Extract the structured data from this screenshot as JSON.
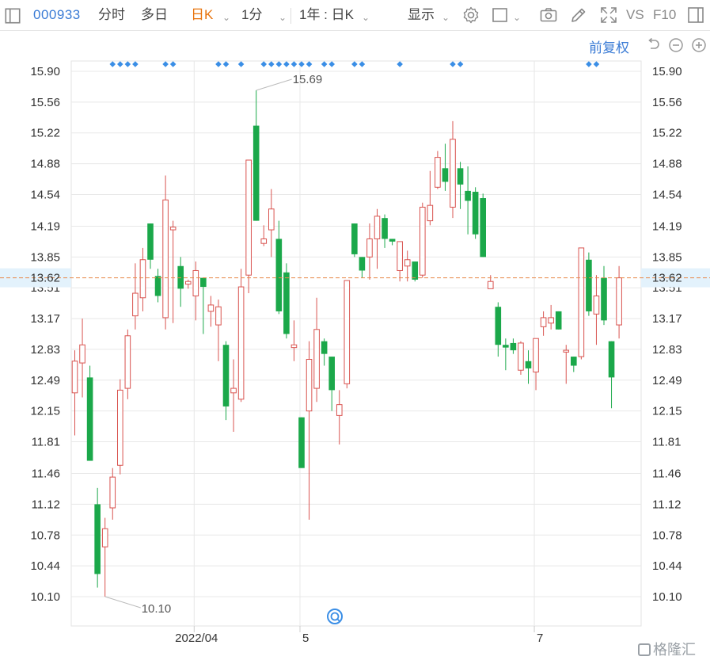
{
  "toolbar": {
    "stock_code": "000933",
    "tab_intraday": "分时",
    "tab_multiday": "多日",
    "tab_daily": "日K",
    "tab_minute": "1分",
    "range_label": "1年 : 日K",
    "display_label": "显示",
    "vs_label": "VS",
    "f10_label": "F10",
    "icons": [
      "layout-icon",
      "settings-gear-icon",
      "rectangle-icon",
      "camera-icon",
      "pencil-icon",
      "fullscreen-icon",
      "sidebar-icon"
    ]
  },
  "controls": {
    "adjust_label": "前复权",
    "icons": [
      "undo-icon",
      "zoom-out-icon",
      "zoom-in-icon"
    ]
  },
  "chart_data": {
    "type": "candlestick",
    "y_ticks": [
      "15.90",
      "15.56",
      "15.22",
      "14.88",
      "14.54",
      "14.19",
      "13.85",
      "13.51",
      "13.17",
      "12.83",
      "12.49",
      "12.15",
      "11.81",
      "11.46",
      "11.12",
      "10.78",
      "10.44",
      "10.10"
    ],
    "ylim": [
      9.95,
      16.2
    ],
    "x_ticks": [
      {
        "label": "2022/04",
        "index": 16
      },
      {
        "label": "5",
        "index": 30
      },
      {
        "label": "7",
        "index": 61
      }
    ],
    "current_price": "13.62",
    "max_label": "15.69",
    "min_label": "10.10",
    "colors": {
      "up": "#d9534f",
      "down": "#1ba84a",
      "price_line": "#e8894a",
      "price_tag_bg": "#e3f2fc",
      "marker": "#3a8ee6",
      "grid": "#e8e8e8"
    },
    "marker_indices": [
      5,
      6,
      7,
      8,
      12,
      13,
      19,
      20,
      22,
      25,
      26,
      27,
      28,
      29,
      30,
      31,
      33,
      34,
      37,
      38,
      43,
      50,
      51,
      68,
      69
    ],
    "candles": [
      {
        "o": 12.35,
        "h": 12.82,
        "l": 11.88,
        "c": 12.7
      },
      {
        "o": 12.68,
        "h": 13.17,
        "l": 12.3,
        "c": 12.88
      },
      {
        "o": 12.52,
        "h": 12.65,
        "l": 11.6,
        "c": 11.6
      },
      {
        "o": 11.12,
        "h": 11.3,
        "l": 10.2,
        "c": 10.35
      },
      {
        "o": 10.65,
        "h": 10.97,
        "l": 10.1,
        "c": 10.85
      },
      {
        "o": 11.08,
        "h": 11.52,
        "l": 10.95,
        "c": 11.42
      },
      {
        "o": 11.55,
        "h": 12.5,
        "l": 11.45,
        "c": 12.38
      },
      {
        "o": 12.4,
        "h": 13.05,
        "l": 12.28,
        "c": 12.98
      },
      {
        "o": 13.2,
        "h": 13.78,
        "l": 13.05,
        "c": 13.45
      },
      {
        "o": 13.4,
        "h": 13.95,
        "l": 13.25,
        "c": 13.82
      },
      {
        "o": 14.22,
        "h": 14.22,
        "l": 13.72,
        "c": 13.82
      },
      {
        "o": 13.64,
        "h": 13.72,
        "l": 13.35,
        "c": 13.42
      },
      {
        "o": 13.18,
        "h": 14.75,
        "l": 13.05,
        "c": 14.48
      },
      {
        "o": 14.15,
        "h": 14.25,
        "l": 13.12,
        "c": 14.18
      },
      {
        "o": 13.75,
        "h": 13.85,
        "l": 13.3,
        "c": 13.5
      },
      {
        "o": 13.55,
        "h": 13.6,
        "l": 13.5,
        "c": 13.58
      },
      {
        "o": 13.42,
        "h": 13.8,
        "l": 13.15,
        "c": 13.7
      },
      {
        "o": 13.62,
        "h": 13.62,
        "l": 13.0,
        "c": 13.52
      },
      {
        "o": 13.25,
        "h": 13.42,
        "l": 13.08,
        "c": 13.32
      },
      {
        "o": 13.1,
        "h": 13.38,
        "l": 12.7,
        "c": 13.3
      },
      {
        "o": 12.88,
        "h": 12.92,
        "l": 12.05,
        "c": 12.2
      },
      {
        "o": 12.35,
        "h": 12.72,
        "l": 11.92,
        "c": 12.4
      },
      {
        "o": 12.28,
        "h": 13.72,
        "l": 12.25,
        "c": 13.52
      },
      {
        "o": 13.65,
        "h": 14.92,
        "l": 13.45,
        "c": 14.92
      },
      {
        "o": 15.3,
        "h": 15.69,
        "l": 14.25,
        "c": 14.25
      },
      {
        "o": 14.0,
        "h": 14.2,
        "l": 13.97,
        "c": 14.05
      },
      {
        "o": 14.15,
        "h": 14.6,
        "l": 13.85,
        "c": 14.38
      },
      {
        "o": 14.05,
        "h": 14.25,
        "l": 13.22,
        "c": 13.25
      },
      {
        "o": 13.68,
        "h": 13.78,
        "l": 12.95,
        "c": 13.0
      },
      {
        "o": 12.85,
        "h": 13.15,
        "l": 12.7,
        "c": 12.88
      },
      {
        "o": 12.08,
        "h": 12.08,
        "l": 11.52,
        "c": 11.52
      },
      {
        "o": 12.15,
        "h": 12.92,
        "l": 10.95,
        "c": 12.72
      },
      {
        "o": 12.4,
        "h": 13.4,
        "l": 12.25,
        "c": 13.05
      },
      {
        "o": 12.92,
        "h": 12.95,
        "l": 12.65,
        "c": 12.78
      },
      {
        "o": 12.75,
        "h": 12.75,
        "l": 12.15,
        "c": 12.38
      },
      {
        "o": 12.1,
        "h": 12.38,
        "l": 11.78,
        "c": 12.22
      },
      {
        "o": 12.45,
        "h": 13.59,
        "l": 12.4,
        "c": 13.59
      },
      {
        "o": 14.22,
        "h": 14.22,
        "l": 13.85,
        "c": 13.88
      },
      {
        "o": 13.85,
        "h": 13.85,
        "l": 13.62,
        "c": 13.7
      },
      {
        "o": 13.85,
        "h": 14.22,
        "l": 13.6,
        "c": 14.05
      },
      {
        "o": 14.05,
        "h": 14.38,
        "l": 13.72,
        "c": 14.3
      },
      {
        "o": 14.28,
        "h": 14.32,
        "l": 13.95,
        "c": 14.05
      },
      {
        "o": 14.05,
        "h": 14.05,
        "l": 13.98,
        "c": 14.02
      },
      {
        "o": 13.7,
        "h": 14.02,
        "l": 13.58,
        "c": 14.02
      },
      {
        "o": 13.75,
        "h": 13.92,
        "l": 13.58,
        "c": 13.82
      },
      {
        "o": 13.8,
        "h": 13.8,
        "l": 13.58,
        "c": 13.6
      },
      {
        "o": 13.65,
        "h": 14.45,
        "l": 13.62,
        "c": 14.4
      },
      {
        "o": 14.25,
        "h": 14.8,
        "l": 14.2,
        "c": 14.42
      },
      {
        "o": 14.62,
        "h": 15.02,
        "l": 14.6,
        "c": 14.95
      },
      {
        "o": 14.83,
        "h": 15.1,
        "l": 14.58,
        "c": 14.68
      },
      {
        "o": 14.4,
        "h": 15.35,
        "l": 14.28,
        "c": 15.15
      },
      {
        "o": 14.83,
        "h": 14.9,
        "l": 14.38,
        "c": 14.65
      },
      {
        "o": 14.58,
        "h": 14.85,
        "l": 14.1,
        "c": 14.47
      },
      {
        "o": 14.57,
        "h": 14.62,
        "l": 14.05,
        "c": 14.1
      },
      {
        "o": 14.5,
        "h": 14.55,
        "l": 13.85,
        "c": 13.85
      },
      {
        "o": 13.5,
        "h": 13.65,
        "l": 13.5,
        "c": 13.58
      },
      {
        "o": 13.3,
        "h": 13.35,
        "l": 12.75,
        "c": 12.88
      },
      {
        "o": 12.88,
        "h": 12.95,
        "l": 12.6,
        "c": 12.85
      },
      {
        "o": 12.9,
        "h": 12.95,
        "l": 12.78,
        "c": 12.82
      },
      {
        "o": 12.6,
        "h": 12.92,
        "l": 12.55,
        "c": 12.9
      },
      {
        "o": 12.7,
        "h": 12.82,
        "l": 12.45,
        "c": 12.62
      },
      {
        "o": 12.58,
        "h": 12.95,
        "l": 12.38,
        "c": 12.95
      },
      {
        "o": 13.08,
        "h": 13.25,
        "l": 12.98,
        "c": 13.18
      },
      {
        "o": 13.12,
        "h": 13.32,
        "l": 13.05,
        "c": 13.18
      },
      {
        "o": 13.25,
        "h": 13.25,
        "l": 13.05,
        "c": 13.05
      },
      {
        "o": 12.8,
        "h": 12.88,
        "l": 12.45,
        "c": 12.82
      },
      {
        "o": 12.75,
        "h": 12.75,
        "l": 12.58,
        "c": 12.65
      },
      {
        "o": 12.75,
        "h": 13.95,
        "l": 12.72,
        "c": 13.95
      },
      {
        "o": 13.82,
        "h": 13.9,
        "l": 13.2,
        "c": 13.25
      },
      {
        "o": 13.22,
        "h": 13.65,
        "l": 12.88,
        "c": 13.42
      },
      {
        "o": 13.62,
        "h": 13.75,
        "l": 13.1,
        "c": 13.15
      },
      {
        "o": 12.92,
        "h": 12.92,
        "l": 12.18,
        "c": 12.52
      },
      {
        "o": 13.1,
        "h": 13.75,
        "l": 12.95,
        "c": 13.62
      }
    ]
  },
  "watermark": "格隆汇"
}
